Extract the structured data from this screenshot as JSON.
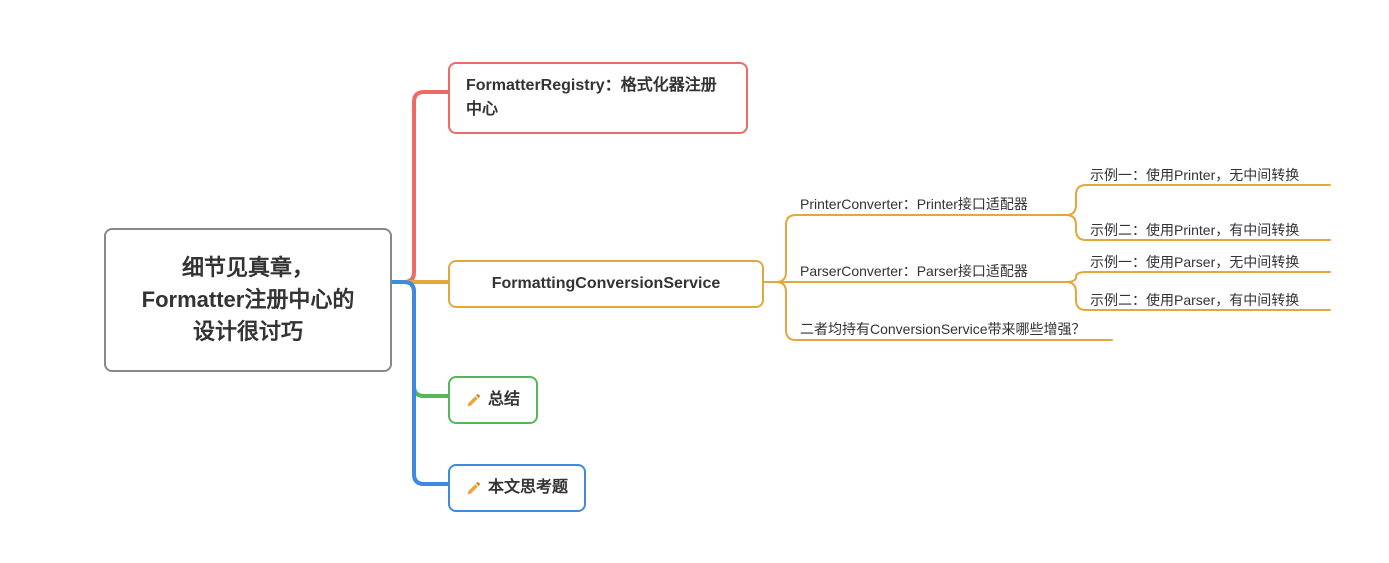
{
  "root": {
    "title_l1": "细节见真章，",
    "title_l2": "Formatter注册中心的",
    "title_l3": "设计很讨巧"
  },
  "branches": {
    "b1": {
      "label": "FormatterRegistry：格式化器注册中心",
      "color": "red"
    },
    "b2": {
      "label": "FormattingConversionService",
      "color": "orange"
    },
    "b3": {
      "label": "总结",
      "color": "green"
    },
    "b4": {
      "label": "本文思考题",
      "color": "blue"
    }
  },
  "b2_children": {
    "c1": {
      "label": "PrinterConverter：Printer接口适配器"
    },
    "c2": {
      "label": "ParserConverter：Parser接口适配器"
    },
    "c3": {
      "label": "二者均持有ConversionService带来哪些增强？"
    }
  },
  "b2_c1_children": {
    "g1": {
      "label": "示例一：使用Printer，无中间转换"
    },
    "g2": {
      "label": "示例二：使用Printer，有中间转换"
    }
  },
  "b2_c2_children": {
    "g3": {
      "label": "示例一：使用Parser，无中间转换"
    },
    "g4": {
      "label": "示例二：使用Parser，有中间转换"
    }
  },
  "colors": {
    "red": "#ed6b66",
    "orange": "#e3a83d",
    "green": "#55b65a",
    "blue": "#3f8ae0"
  },
  "icons": {
    "pencil": "✏️"
  }
}
